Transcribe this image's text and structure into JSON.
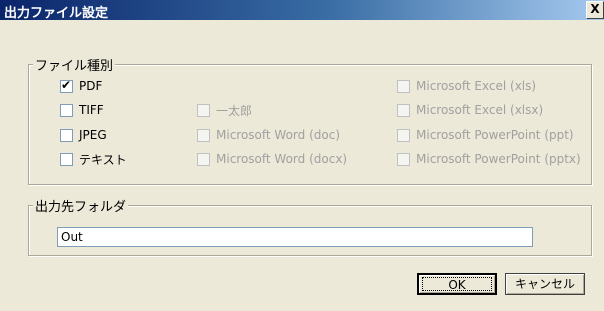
{
  "window": {
    "title": "出力ファイル設定",
    "close_glyph": "X"
  },
  "file_type_group": {
    "legend": "ファイル種別",
    "options": [
      {
        "label": "PDF",
        "checked": true,
        "enabled": true
      },
      {
        "label": "TIFF",
        "checked": false,
        "enabled": true
      },
      {
        "label": "JPEG",
        "checked": false,
        "enabled": true
      },
      {
        "label": "テキスト",
        "checked": false,
        "enabled": true
      },
      {
        "label": "一太郎",
        "checked": false,
        "enabled": false
      },
      {
        "label": "Microsoft Word (doc)",
        "checked": false,
        "enabled": false
      },
      {
        "label": "Microsoft Word (docx)",
        "checked": false,
        "enabled": false
      },
      {
        "label": "Microsoft Excel (xls)",
        "checked": false,
        "enabled": false
      },
      {
        "label": "Microsoft Excel (xlsx)",
        "checked": false,
        "enabled": false
      },
      {
        "label": "Microsoft PowerPoint (ppt)",
        "checked": false,
        "enabled": false
      },
      {
        "label": "Microsoft PowerPoint (pptx)",
        "checked": false,
        "enabled": false
      }
    ]
  },
  "output_folder_group": {
    "legend": "出力先フォルダ",
    "value": "Out"
  },
  "buttons": {
    "ok": "OK",
    "cancel": "キャンセル"
  },
  "colors": {
    "title_start": "#0a246a",
    "title_end": "#a6caf0",
    "dialog_bg": "#ece9d8"
  }
}
